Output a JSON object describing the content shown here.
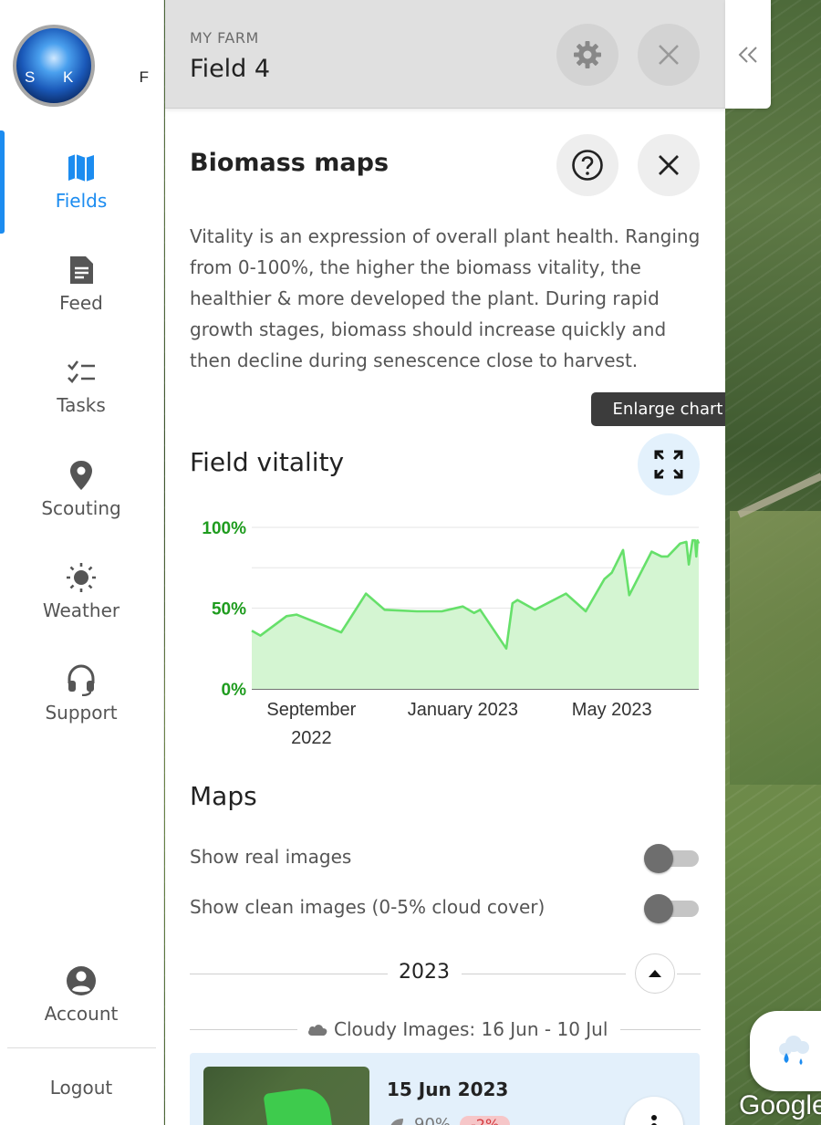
{
  "brand": {
    "logo_text_light": "S K Y",
    "logo_text_dark": "F L D"
  },
  "nav": {
    "items": [
      {
        "label": "Fields",
        "icon": "map-icon",
        "active": true
      },
      {
        "label": "Feed",
        "icon": "document-icon"
      },
      {
        "label": "Tasks",
        "icon": "checklist-icon"
      },
      {
        "label": "Scouting",
        "icon": "location-pin-icon"
      },
      {
        "label": "Weather",
        "icon": "sun-icon"
      },
      {
        "label": "Support",
        "icon": "headset-icon"
      }
    ],
    "account_label": "Account",
    "logout_label": "Logout",
    "accent_color": "#1c8cf0"
  },
  "header": {
    "farm_label": "MY FARM",
    "field_name": "Field 4"
  },
  "biomass": {
    "title": "Biomass maps",
    "description": "Vitality is an expression of overall plant health. Ranging from 0-100%, the higher the biomass vitality, the healthier & more developed the plant. During rapid growth stages, biomass should increase quickly and then decline during senescence close to harvest."
  },
  "vitality": {
    "title": "Field vitality",
    "enlarge_tooltip": "Enlarge chart"
  },
  "chart_data": {
    "type": "area",
    "title": "",
    "xlabel": "",
    "ylabel": "",
    "ylim": [
      0,
      100
    ],
    "y_ticks": [
      "0%",
      "50%",
      "100%"
    ],
    "x_ticks": [
      {
        "line1": "September",
        "line2": "2022",
        "x": "2022-09-01"
      },
      {
        "line1": "January 2023",
        "line2": "",
        "x": "2023-01-01"
      },
      {
        "line1": "May 2023",
        "line2": "",
        "x": "2023-05-01"
      }
    ],
    "x_range": [
      "2022-07-15",
      "2023-07-10"
    ],
    "series": [
      {
        "line_color": "#66e06a",
        "fill_color": "#d4f5d2",
        "points": [
          [
            "2022-07-15",
            36
          ],
          [
            "2022-07-22",
            33
          ],
          [
            "2022-08-12",
            45
          ],
          [
            "2022-08-20",
            46
          ],
          [
            "2022-09-25",
            35
          ],
          [
            "2022-10-15",
            59
          ],
          [
            "2022-10-30",
            49
          ],
          [
            "2022-11-25",
            48
          ],
          [
            "2022-12-15",
            48
          ],
          [
            "2023-01-01",
            51
          ],
          [
            "2023-01-10",
            47
          ],
          [
            "2023-01-15",
            49
          ],
          [
            "2023-02-05",
            25
          ],
          [
            "2023-02-10",
            53
          ],
          [
            "2023-02-14",
            55
          ],
          [
            "2023-02-28",
            49
          ],
          [
            "2023-03-25",
            59
          ],
          [
            "2023-04-10",
            48
          ],
          [
            "2023-04-25",
            68
          ],
          [
            "2023-05-01",
            72
          ],
          [
            "2023-05-10",
            86
          ],
          [
            "2023-05-15",
            58
          ],
          [
            "2023-06-02",
            85
          ],
          [
            "2023-06-10",
            82
          ],
          [
            "2023-06-15",
            82
          ],
          [
            "2023-06-25",
            90
          ],
          [
            "2023-06-30",
            91
          ],
          [
            "2023-07-02",
            77
          ],
          [
            "2023-07-05",
            92
          ],
          [
            "2023-07-07",
            92
          ],
          [
            "2023-07-08",
            82
          ],
          [
            "2023-07-09",
            92
          ],
          [
            "2023-07-10",
            90
          ]
        ]
      }
    ],
    "grid": true,
    "y_tick_color": "#1f9c1f"
  },
  "maps": {
    "title": "Maps",
    "toggle_real": "Show real images",
    "toggle_clean": "Show clean images (0-5% cloud cover)",
    "year": "2023",
    "cloudy_label": "Cloudy Images: 16 Jun - 10 Jul",
    "card": {
      "date": "15 Jun 2023",
      "vitality": "90%",
      "change": "-2%"
    }
  },
  "map": {
    "attribution": "Google"
  }
}
